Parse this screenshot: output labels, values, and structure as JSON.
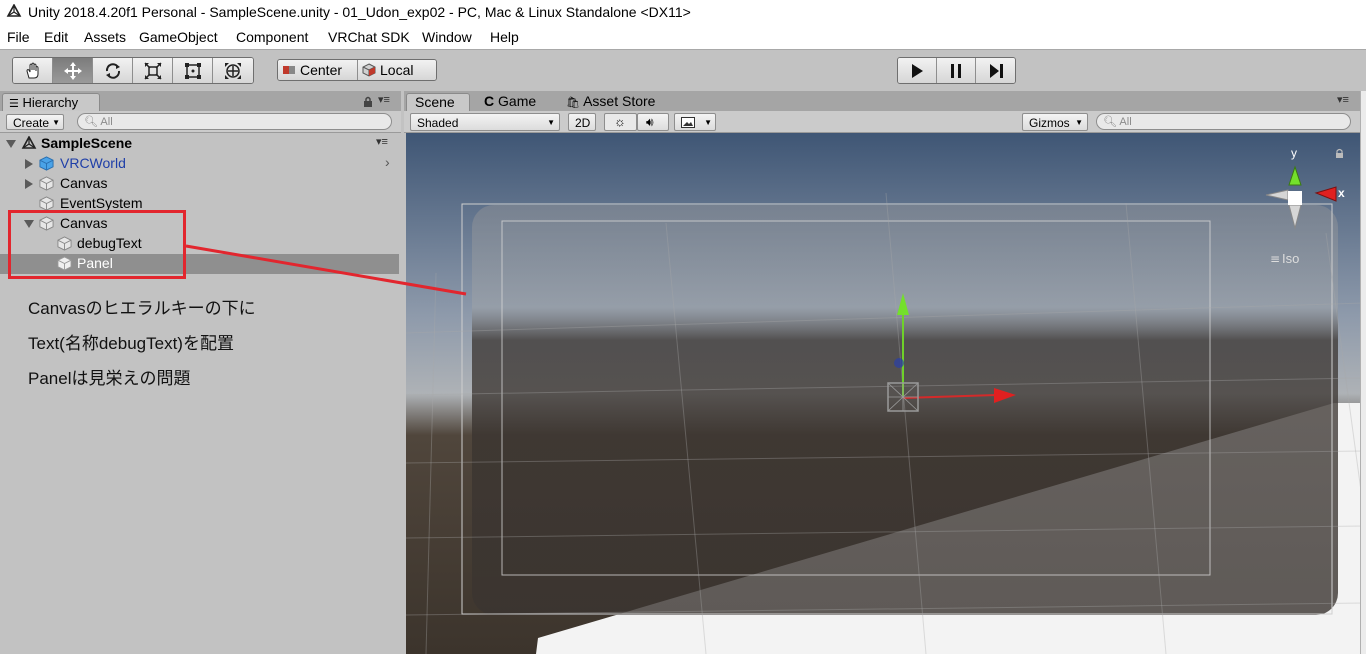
{
  "window": {
    "title": "Unity 2018.4.20f1 Personal - SampleScene.unity - 01_Udon_exp02 - PC, Mac & Linux Standalone <DX11>"
  },
  "menu": [
    "File",
    "Edit",
    "Assets",
    "GameObject",
    "Component",
    "VRChat SDK",
    "Window",
    "Help"
  ],
  "toolbar": {
    "tools": [
      "hand-tool-icon",
      "move-tool-icon",
      "rotate-tool-icon",
      "scale-tool-icon",
      "rect-tool-icon",
      "transform-tool-icon"
    ],
    "active_tool": "move-tool-icon",
    "pivot_label": "Center",
    "space_label": "Local",
    "play_controls": [
      "play-icon",
      "pause-icon",
      "step-icon"
    ]
  },
  "hierarchy": {
    "tab_label": "Hierarchy",
    "create_label": "Create",
    "search_placeholder": "All",
    "scene_name": "SampleScene",
    "items": [
      {
        "label": "VRCWorld",
        "color": "#1f3fa8",
        "icon": "prefab-cube-icon"
      },
      {
        "label": "Canvas",
        "color": "#000000",
        "icon": "gameobject-cube-icon"
      },
      {
        "label": "EventSystem",
        "color": "#000000",
        "icon": "gameobject-cube-icon"
      },
      {
        "label": "Canvas",
        "color": "#000000",
        "icon": "gameobject-cube-icon"
      },
      {
        "label": "debugText",
        "color": "#000000",
        "icon": "gameobject-cube-icon"
      },
      {
        "label": "Panel",
        "color": "#ffffff",
        "icon": "gameobject-cube-icon",
        "selected": true
      }
    ]
  },
  "annotation": {
    "lines": [
      "Canvasのヒエラルキーの下に",
      "Text(名称debugText)を配置",
      "Panelは見栄えの問題"
    ],
    "color": "#e2262e"
  },
  "scene": {
    "tabs": [
      "Scene",
      "Game",
      "Asset Store"
    ],
    "active_tab": "Scene",
    "shading_mode": "Shaded",
    "mode_2d_label": "2D",
    "gizmos_label": "Gizmos",
    "search_placeholder": "All",
    "view_label": "Iso",
    "axis_labels": {
      "y": "y",
      "x": "x"
    }
  }
}
